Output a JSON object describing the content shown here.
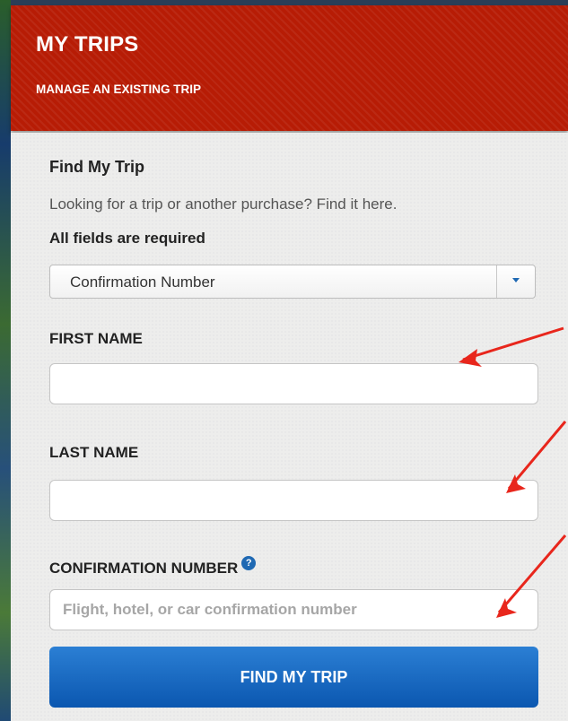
{
  "header": {
    "title": "MY TRIPS",
    "subtitle": "MANAGE AN EXISTING TRIP",
    "bg_color": "#b71c05"
  },
  "form": {
    "section_title": "Find My Trip",
    "intro": "Looking for a trip or another purchase? Find it here.",
    "required_note": "All fields are required",
    "lookup_type": {
      "selected": "Confirmation Number",
      "icon": "chevron-down-icon"
    },
    "first_name": {
      "label": "FIRST NAME",
      "value": ""
    },
    "last_name": {
      "label": "LAST NAME",
      "value": ""
    },
    "confirmation_number": {
      "label": "CONFIRMATION NUMBER",
      "value": "",
      "placeholder": "Flight, hotel, or car confirmation number",
      "help_icon": "question-mark-icon"
    },
    "submit_label": "FIND MY TRIP",
    "submit_color": "#1565c0"
  },
  "annotations": {
    "arrow_color": "#e8261c",
    "icon": "red-arrow-icon"
  }
}
